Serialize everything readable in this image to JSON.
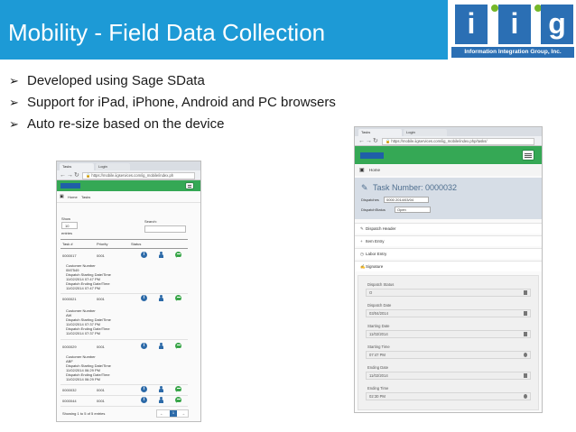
{
  "slide": {
    "title": "Mobility - Field Data Collection",
    "logo_letters": [
      "i",
      "i",
      "g"
    ],
    "logo_subtitle": "Information Integration Group, Inc.",
    "bullets": [
      "Developed using Sage SData",
      "Support for iPad, iPhone, Android and PC browsers",
      "Auto re-size based on the device"
    ]
  },
  "colors": {
    "header": "#1d9ad6",
    "logo": "#2b6fb4",
    "logo_dot": "#76b82a",
    "app_bar": "#35a855"
  },
  "left_browser": {
    "tabs": [
      "Tasks",
      "Login"
    ],
    "url": "https://mobile.iigservices.com/ig_mobile/index.ph",
    "breadcrumb": [
      "Home",
      "Tasks"
    ],
    "rows_label": "Show",
    "rows_value": "10",
    "entries_label": "entries",
    "search_label": "Search:",
    "columns": [
      "Task #",
      "Priority",
      "Status"
    ],
    "tasks": [
      {
        "number": "0000017",
        "code": "0001",
        "details": [
          "Customer Number",
          "0M7549",
          "Dispatch Starting Date/Time",
          "11/02/2014 07:47 PM",
          "Dispatch Ending Date/Time",
          "11/02/2014 07:47 PM"
        ]
      },
      {
        "number": "0000021",
        "code": "0001",
        "details": [
          "Customer Number",
          "AW",
          "Dispatch Starting Date/Time",
          "11/02/2014 07:37 PM",
          "Dispatch Ending Date/Time",
          "11/02/2014 07:37 PM"
        ]
      },
      {
        "number": "0000029",
        "code": "0001",
        "details": [
          "Customer Number",
          "ABF",
          "Dispatch Starting Date/Time",
          "11/02/2014 06:29 PM",
          "Dispatch Ending Date/Time",
          "11/02/2014 06:29 PM"
        ]
      },
      {
        "number": "0000032",
        "code": "0001",
        "details": []
      },
      {
        "number": "0000044",
        "code": "0001",
        "details": []
      }
    ],
    "footer": "Showing 1 to 5 of 5 entries",
    "pagination": [
      "←",
      "1",
      "→"
    ]
  },
  "right_browser": {
    "tabs": [
      "Tasks",
      "Login"
    ],
    "url": "https://mobile.iigservices.com/iig_mobile/index.php/tasks/",
    "breadcrumb": "Home",
    "task_title": "Task Number: 0000032",
    "dispatches_label": "Dispatches",
    "dispatches_value": "0000 2014/03/04",
    "dispatch_status_label": "DispatchStatus",
    "dispatch_status_value": "Open",
    "sections": [
      "Dispatch Header",
      "Item Entry",
      "Labor Entry",
      "Signature"
    ],
    "fields": [
      {
        "label": "Dispatch Status",
        "value": "O"
      },
      {
        "label": "Dispatch Date",
        "value": "03/04/2014"
      },
      {
        "label": "Starting Date",
        "value": "11/02/2014"
      },
      {
        "label": "Starting Time",
        "value": "07:47 PM"
      },
      {
        "label": "Ending Date",
        "value": "11/02/2014"
      },
      {
        "label": "Ending Time",
        "value": "02:30 PM"
      }
    ]
  }
}
